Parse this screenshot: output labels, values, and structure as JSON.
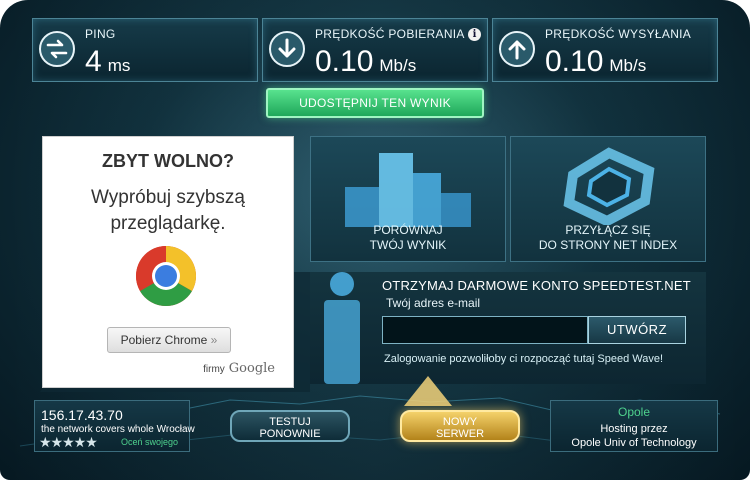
{
  "metrics": {
    "ping": {
      "label": "PING",
      "value": "4",
      "unit": "ms",
      "icon": "swap-arrows-icon"
    },
    "download": {
      "label": "PRĘDKOŚĆ POBIERANIA",
      "value": "0.10",
      "unit": "Mb/s",
      "icon": "arrow-down-icon",
      "info": "i"
    },
    "upload": {
      "label": "PRĘDKOŚĆ WYSYŁANIA",
      "value": "0.10",
      "unit": "Mb/s",
      "icon": "arrow-up-icon"
    }
  },
  "share": {
    "label": "UDOSTĘPNIJ TEN WYNIK"
  },
  "ad": {
    "heading": "ZBYT WOLNO?",
    "line1": "Wypróbuj szybszą",
    "line2": "przeglądarkę.",
    "button": "Pobierz Chrome",
    "button_suffix": "»",
    "footer_prefix": "firmy",
    "footer_brand": "Google"
  },
  "tiles": {
    "compare": {
      "line1": "PORÓWNAJ",
      "line2": "TWÓJ WYNIK"
    },
    "netindex": {
      "line1": "PRZYŁĄCZ SIĘ",
      "line2": "DO STRONY NET INDEX"
    }
  },
  "account": {
    "title": "OTRZYMAJ DARMOWE KONTO SPEEDTEST.NET",
    "email_label": "Twój adres e-mail",
    "email_value": "",
    "create": "UTWÓRZ",
    "note": "Zalogowanie pozwoliłoby ci rozpocząć tutaj Speed Wave!"
  },
  "status": {
    "ip": "156.17.43.70",
    "network": "the network covers whole Wrocław",
    "stars": "★★★★★",
    "rate_text": "Oceń swojego"
  },
  "buttons": {
    "retest_line1": "TESTUJ",
    "retest_line2": "PONOWNIE",
    "newserver_line1": "NOWY",
    "newserver_line2": "SERWER"
  },
  "server": {
    "city": "Opole",
    "hosted_by": "Hosting przez",
    "host": "Opole Univ of Technology"
  },
  "colors": {
    "accent_green": "#1fa75a",
    "gold": "#d6a53a",
    "panel": "#12323e"
  }
}
